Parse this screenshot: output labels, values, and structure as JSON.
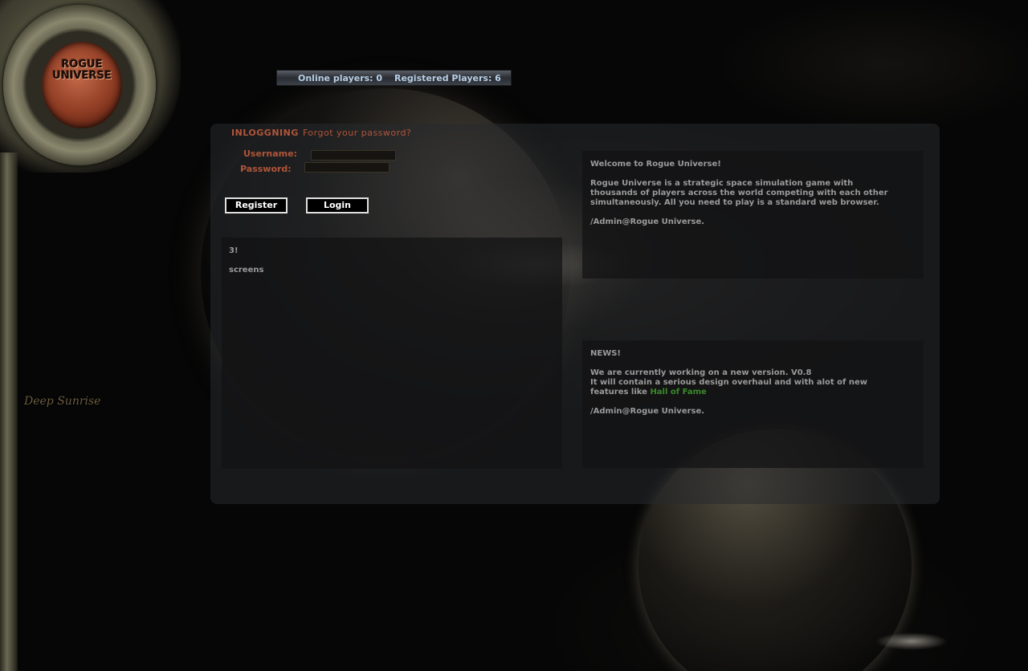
{
  "logo": {
    "line1": "ROGUE",
    "line2": "UNIVERSE"
  },
  "credit": "Deep Sunrise",
  "stats": {
    "online": "Online players: 0",
    "registered": "Registered Players: 6"
  },
  "login": {
    "title": "INLOGGNING",
    "forgot": "Forgot your password?",
    "username_label": "Username:",
    "password_label": "Password:",
    "username_value": "",
    "password_value": "",
    "register_button": "Register",
    "login_button": "Login"
  },
  "screens_box": {
    "line1": "3!",
    "line2": "screens"
  },
  "welcome_box": {
    "heading": "Welcome to Rogue Universe!",
    "body": "Rogue Universe is a strategic space simulation game with thousands of players across the world competing with each other simultaneously. All you need to play is a standard web browser.",
    "signature": "/Admin@Rogue Universe."
  },
  "news_box": {
    "heading": "NEWS!",
    "line1": "We are currently working on a new version. V0.8",
    "line2_prefix": "It will contain a serious design overhaul and with alot of new features like",
    "link": "Hall of Fame",
    "signature": "/Admin@Rogue Universe."
  }
}
